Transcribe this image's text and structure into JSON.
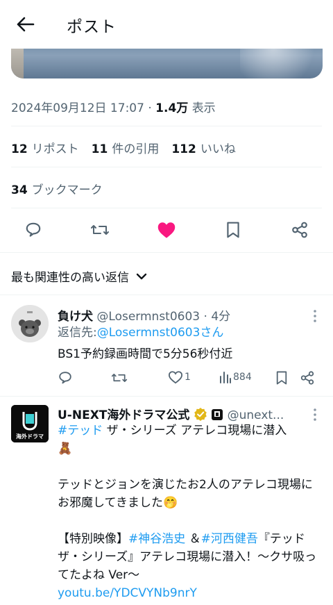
{
  "header": {
    "title": "ポスト"
  },
  "post": {
    "timestamp": "2024年09月12日 17:07",
    "separator": "·",
    "views_count": "1.4万",
    "views_label": "表示",
    "reposts_count": "12",
    "reposts_label": "リポスト",
    "quotes_count": "11",
    "quotes_label": "件の引用",
    "likes_count": "112",
    "likes_label": "いいね",
    "bookmarks_count": "34",
    "bookmarks_label": "ブックマーク",
    "liked": true,
    "like_color": "#f91880"
  },
  "sort": {
    "label": "最も関連性の高い返信"
  },
  "replies": [
    {
      "name": "負け犬",
      "handle": "@Losermnst0603",
      "time": "· 4分",
      "reply_to_prefix": "返信先:",
      "reply_to_handle": "@Losermnst0603さん",
      "text": "BS1予約録画時間で5分56秒付近",
      "like_count": "1",
      "view_count": "884"
    },
    {
      "name": "U-NEXT海外ドラマ公式",
      "handle": "@unext...",
      "avatar_label": "海外ドラマ",
      "line1_hashtag": "#テッド",
      "line1_rest": " ザ・シリーズ アテレコ現場に潜入",
      "line1_emoji": "🧸",
      "para2": "テッドとジョンを演じたお2人のアテレコ現場にお邪魔してきました🤭",
      "para3_prefix": "【特別映像】",
      "para3_tag1": "#神谷浩史",
      "para3_amp": " ＆",
      "para3_tag2": "#河西健吾",
      "para3_rest": "『テッド ザ・シリーズ』アテレコ現場に潜入！～クサ吸ってたよね Ver～",
      "link": "youtu.be/YDCVYNb9nrY"
    }
  ],
  "colors": {
    "accent": "#1d9bf0",
    "muted": "#536471",
    "text": "#0f1419"
  }
}
